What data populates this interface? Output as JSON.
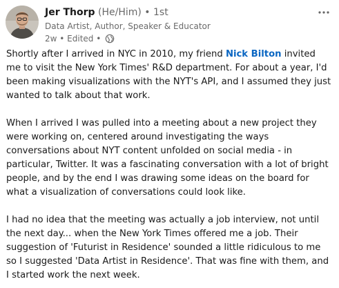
{
  "author": {
    "name": "Jer Thorp",
    "pronouns": "(He/Him)",
    "degree": "• 1st",
    "headline": "Data Artist, Author, Speaker & Educator",
    "time": "2w",
    "edited": "• Edited •",
    "visibility_icon": "globe-icon"
  },
  "menu_icon": "more-options-icon",
  "colors": {
    "mention": "#0a66c2",
    "secondary_text": "#666666"
  },
  "post": {
    "p1_before": "Shortly after I arrived in NYC in 2010, my friend ",
    "p1_mention": "Nick Bilton",
    "p1_after": " invited me to visit the New York Times' R&D department. For about a year, I'd been making visualizations with the NYT's API, and I assumed they just wanted to talk about that work.",
    "p2": "When I arrived I was pulled into a meeting about a new project they were working on, centered around investigating the ways conversations about NYT content unfolded on social media - in particular, Twitter. It was a fascinating conversation with a lot of bright people, and by the end I was drawing some ideas on the board for what a visualization of conversations could look like.",
    "p3": "I had no idea that the meeting was actually a job interview, not until the next day... when the New York Times offered me a job. Their suggestion of 'Futurist in Residence' sounded a little ridiculous to me so I suggested 'Data Artist in Residence'. That was fine with them, and I started work the next week."
  }
}
